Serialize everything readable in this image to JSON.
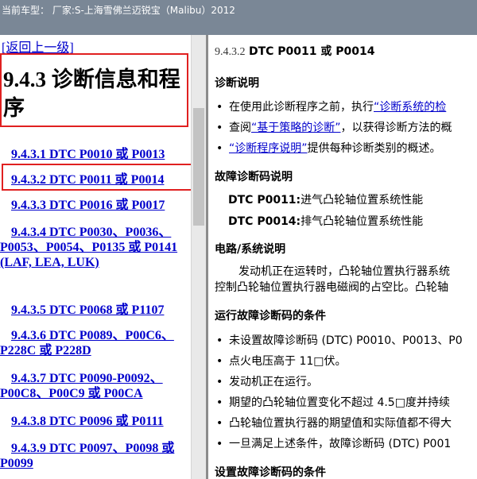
{
  "header": {
    "vehicle_text": "当前车型：  厂家:S-上海雪佛兰迈锐宝（Malibu）2012"
  },
  "left": {
    "back_label": "[返回上一级]",
    "title": "9.4.3 诊断信息和程序",
    "links": [
      "9.4.3.1 DTC P0010 或 P0013",
      "9.4.3.2 DTC P0011 或 P0014",
      "9.4.3.3 DTC P0016 或 P0017",
      "9.4.3.4 DTC P0030、P0036、P0053、P0054、P0135 或 P0141 (LAF, LEA, LUK)",
      "9.4.3.5 DTC P0068 或 P1107",
      "9.4.3.6 DTC P0089、P00C6、P228C 或 P228D",
      "9.4.3.7 DTC P0090-P0092、P00C8、P00C9 或 P00CA",
      "9.4.3.8 DTC P0096 或 P0111",
      "9.4.3.9 DTC P0097、P0098 或 P0099"
    ]
  },
  "right": {
    "title_num": "9.4.3.2",
    "title_dtc": "DTC P0011 或 P0014",
    "diag_heading": "诊断说明",
    "diag_b1_pre": "在使用此诊断程序之前，执行",
    "diag_b1_link": "“诊断系统的检",
    "diag_b2_pre": "查阅",
    "diag_b2_link": "“基于策略的诊断”",
    "diag_b2_post": "，以获得诊断方法的概",
    "diag_b3_link": "“诊断程序说明”",
    "diag_b3_post": "提供每种诊断类别的概述。",
    "dtc_heading": "故障诊断码说明",
    "code1_id": "DTC P0011:",
    "code1_desc": "进气凸轮轴位置系统性能",
    "code2_id": "DTC P0014:",
    "code2_desc": "排气凸轮轴位置系统性能",
    "circuit_heading": "电路/系统说明",
    "circuit_line1": "发动机正在运转时，凸轮轴位置执行器系统",
    "circuit_line2": "控制凸轮轴位置执行器电磁阀的占空比。凸轮轴",
    "run_heading": "运行故障诊断码的条件",
    "run_b1": "未设置故障诊断码 (DTC) P0010、P0013、P0",
    "run_b2": "点火电压高于 11□伏。",
    "run_b3": "发动机正在运行。",
    "run_b4": "期望的凸轮轴位置变化不超过 4.5□度并持续",
    "run_b5": "凸轮轴位置执行器的期望值和实际值都不得大",
    "run_b6": "一旦满足上述条件，故障诊断码 (DTC) P001",
    "set_heading": "设置故障诊断码的条件"
  }
}
